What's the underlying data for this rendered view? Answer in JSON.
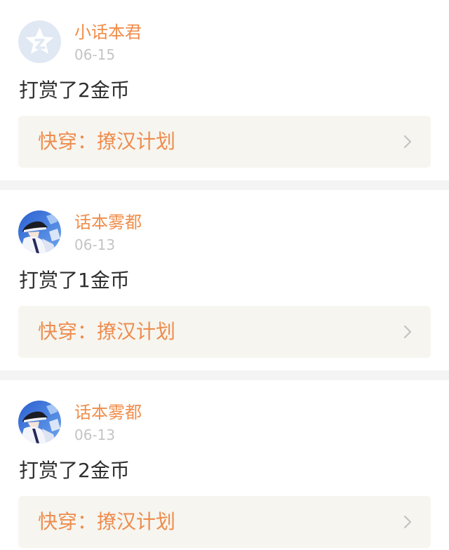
{
  "feed": {
    "items": [
      {
        "username": "小话本君",
        "date": "06-15",
        "action": "打赏了2金币",
        "book_title": "快穿：撩汉计划",
        "avatar_icon": "qq-default-avatar-icon"
      },
      {
        "username": "话本雾都",
        "date": "06-13",
        "action": "打赏了1金币",
        "book_title": "快穿：撩汉计划",
        "avatar_icon": "anime-character-avatar"
      },
      {
        "username": "话本雾都",
        "date": "06-13",
        "action": "打赏了2金币",
        "book_title": "快穿：撩汉计划",
        "avatar_icon": "anime-character-avatar"
      }
    ]
  },
  "colors": {
    "username": "#f08d4a",
    "book_title": "#ee8c4d",
    "date": "#c4c4c4",
    "text": "#2e2e2e",
    "book_link_bg": "#f6f5ef",
    "page_bg": "#f5f4f4"
  }
}
